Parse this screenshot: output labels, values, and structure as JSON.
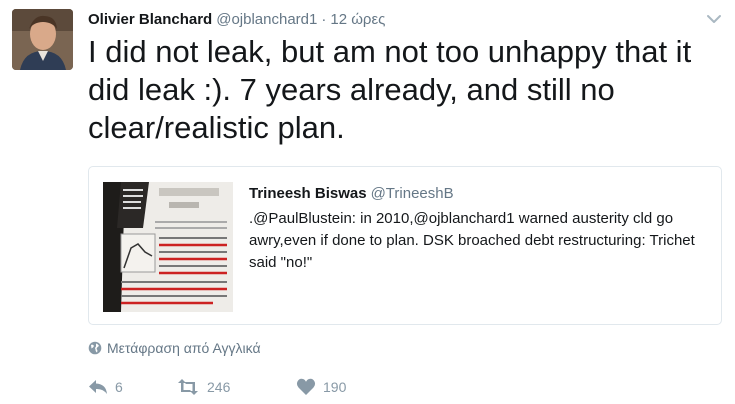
{
  "tweet": {
    "author_name": "Olivier Blanchard",
    "author_handle": "@ojblanchard1",
    "separator": "·",
    "time": "12 ώρες",
    "text": "I did not leak, but am not too unhappy that it did leak :).  7 years already, and still no clear/realistic plan."
  },
  "quoted": {
    "author_name": "Trineesh Biswas",
    "author_handle": "@TrineeshB",
    "text": ".@PaulBlustein: in 2010,@ojblanchard1 warned austerity cld go awry,even if done to plan. DSK broached debt restructuring: Trichet said \"no!\""
  },
  "translate_label": "Μετάφραση από Αγγλικά",
  "actions": {
    "reply_count": "6",
    "retweet_count": "246",
    "like_count": "190"
  },
  "colors": {
    "text": "#14171a",
    "muted": "#657786",
    "action": "#8899a6",
    "border": "#e1e8ed"
  },
  "icons": [
    "chevron-down-icon",
    "globe-icon",
    "reply-icon",
    "retweet-icon",
    "heart-icon"
  ]
}
